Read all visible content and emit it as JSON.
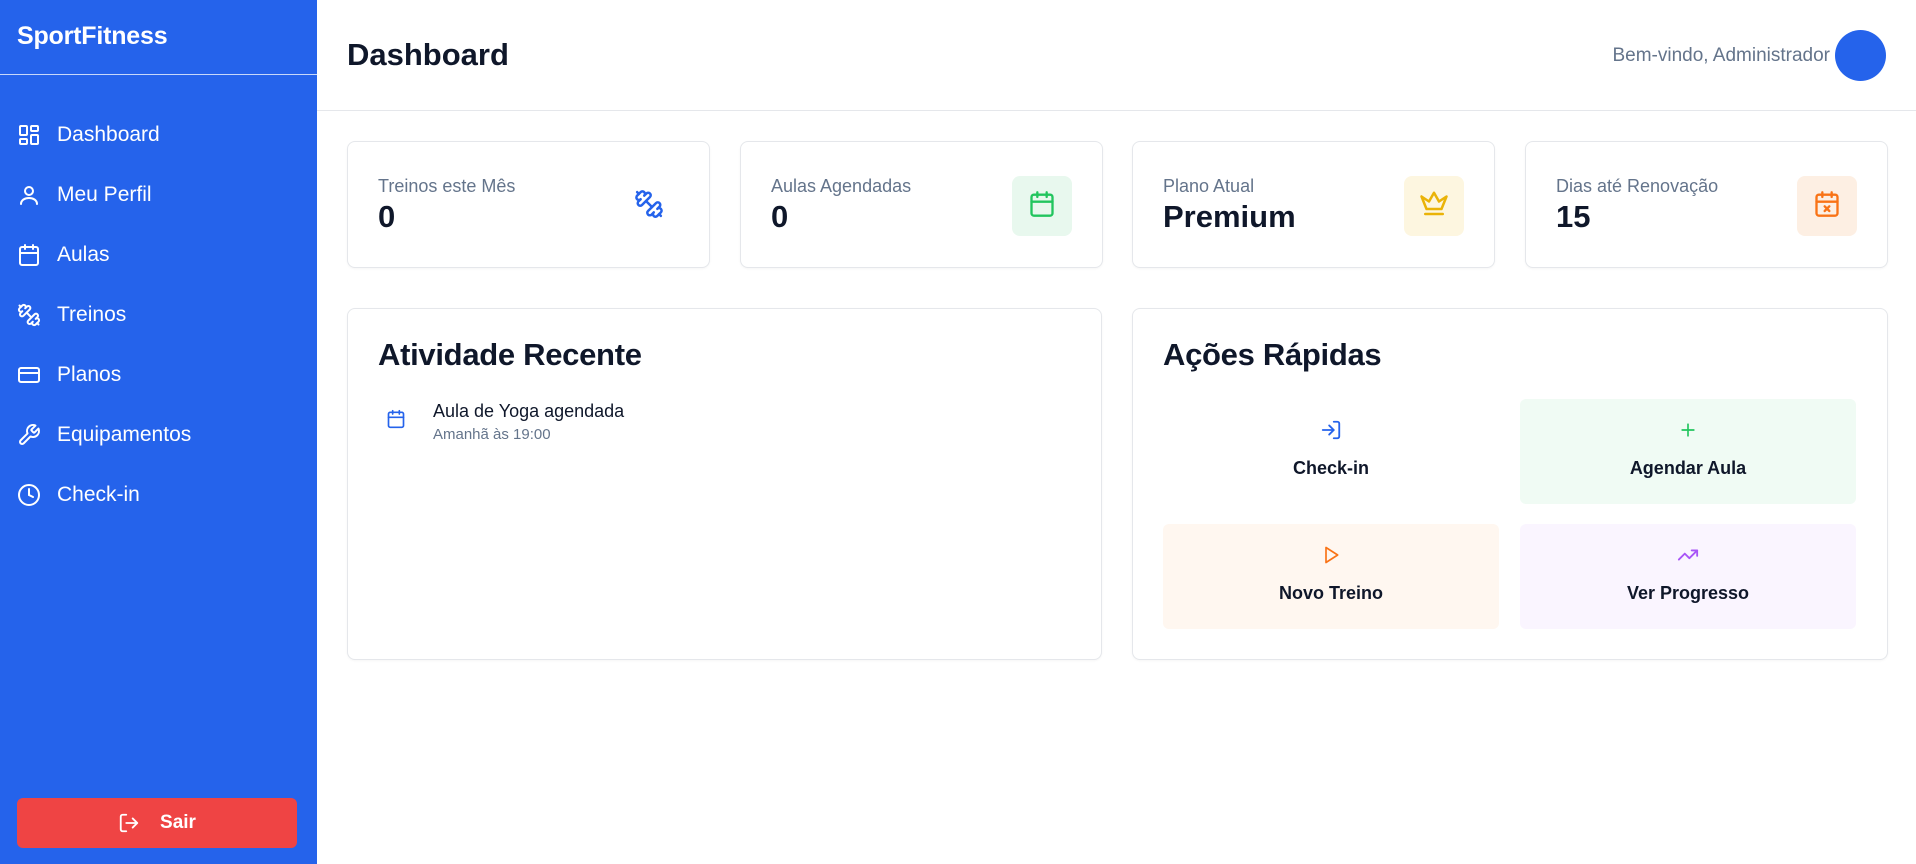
{
  "sidebar": {
    "brand": "SportFitness",
    "items": [
      {
        "label": "Dashboard",
        "icon": "dashboard-icon",
        "active": true
      },
      {
        "label": "Meu Perfil",
        "icon": "user-icon"
      },
      {
        "label": "Aulas",
        "icon": "calendar-icon"
      },
      {
        "label": "Treinos",
        "icon": "dumbbell-icon"
      },
      {
        "label": "Planos",
        "icon": "credit-card-icon"
      },
      {
        "label": "Equipamentos",
        "icon": "wrench-icon"
      },
      {
        "label": "Check-in",
        "icon": "clock-icon"
      }
    ],
    "logout_label": "Sair"
  },
  "header": {
    "title": "Dashboard",
    "welcome": "Bem-vindo, Administrador"
  },
  "stats": [
    {
      "label": "Treinos este Mês",
      "value": "0",
      "icon": "dumbbell-icon",
      "color": "#2563eb",
      "bg": "#ffffff"
    },
    {
      "label": "Aulas Agendadas",
      "value": "0",
      "icon": "calendar-icon",
      "color": "#22c55e",
      "bg": "#e8f8ee"
    },
    {
      "label": "Plano Atual",
      "value": "Premium",
      "icon": "crown-icon",
      "color": "#eab308",
      "bg": "#fdf6e0"
    },
    {
      "label": "Dias até Renovação",
      "value": "15",
      "icon": "calendar-x-icon",
      "color": "#f97316",
      "bg": "#fdefe3"
    }
  ],
  "recent_activity": {
    "title": "Atividade Recente",
    "items": [
      {
        "title": "Aula de Yoga agendada",
        "time": "Amanhã às 19:00",
        "icon": "calendar-icon"
      }
    ]
  },
  "quick_actions": {
    "title": "Ações Rápidas",
    "items": [
      {
        "label": "Check-in",
        "icon": "log-in-icon",
        "color": "#2563eb",
        "bg": "#ffffff"
      },
      {
        "label": "Agendar Aula",
        "icon": "plus-icon",
        "color": "#22c55e",
        "bg": "#f0fbf4"
      },
      {
        "label": "Novo Treino",
        "icon": "play-icon",
        "color": "#f97316",
        "bg": "#fff7f0"
      },
      {
        "label": "Ver Progresso",
        "icon": "trending-up-icon",
        "color": "#a855f7",
        "bg": "#faf5ff"
      }
    ]
  }
}
